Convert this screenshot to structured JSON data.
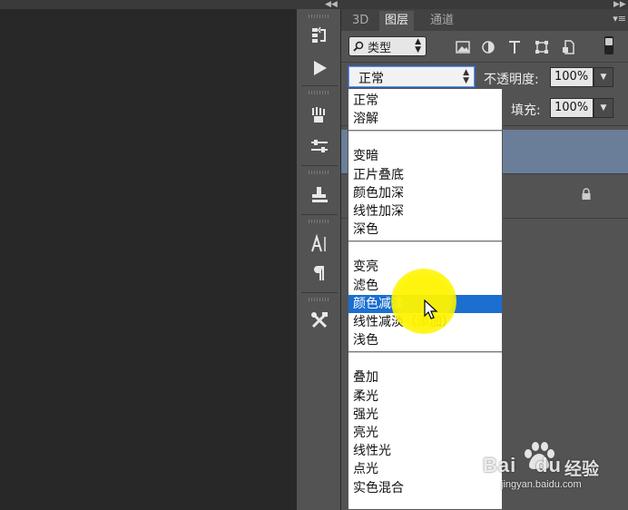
{
  "panel": {
    "tabs": [
      "3D",
      "图层",
      "通道"
    ],
    "active_tab": "图层"
  },
  "filter": {
    "kind_label": "类型"
  },
  "blend": {
    "current": "正常",
    "opacity_label": "不透明度:",
    "opacity_value": "100%",
    "fill_label": "填充:",
    "fill_value": "100%"
  },
  "blend_modes": [
    {
      "label": "正常"
    },
    {
      "label": "溶解"
    },
    {
      "label": "变暗"
    },
    {
      "label": "正片叠底"
    },
    {
      "label": "颜色加深"
    },
    {
      "label": "线性加深"
    },
    {
      "label": "深色"
    },
    {
      "label": "变亮"
    },
    {
      "label": "滤色"
    },
    {
      "label": "颜色减淡",
      "selected": true
    },
    {
      "label": "线性减淡（添加）"
    },
    {
      "label": "浅色"
    },
    {
      "label": "叠加"
    },
    {
      "label": "柔光"
    },
    {
      "label": "强光"
    },
    {
      "label": "亮光"
    },
    {
      "label": "线性光"
    },
    {
      "label": "点光"
    },
    {
      "label": "实色混合"
    }
  ],
  "watermark": {
    "brand": "Bai",
    "brand2": "du",
    "suffix": "经验",
    "url": "jingyan.baidu.com"
  },
  "colors": {
    "accent": "#1a6fd1",
    "highlight": "#fff400",
    "panel": "#535353",
    "layer_selected": "#6b7e99"
  },
  "icons": [
    "history-icon",
    "play-action-icon",
    "brush-presets-icon",
    "adjustments-icon",
    "clone-source-icon",
    "character-icon",
    "paragraph-icon",
    "tool-presets-icon",
    "lock-icon",
    "image-filter-icon",
    "adjustment-filter-icon",
    "type-filter-icon",
    "shape-filter-icon",
    "smart-object-filter-icon"
  ]
}
